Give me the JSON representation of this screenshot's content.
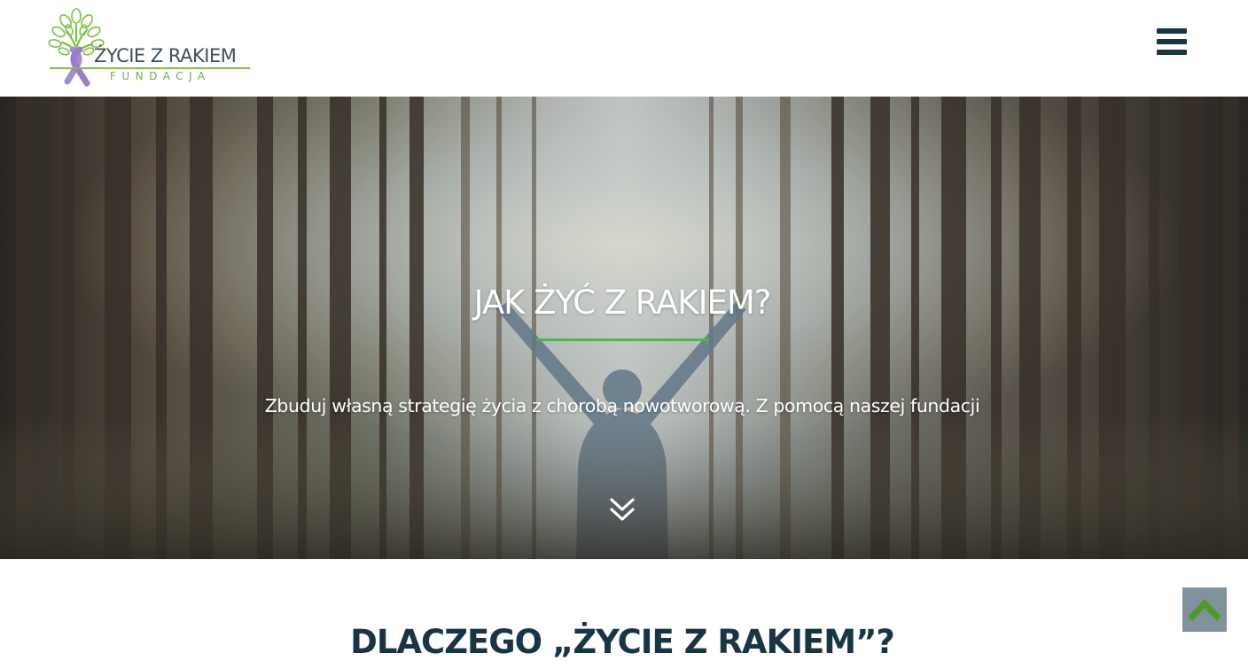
{
  "header": {
    "logo": {
      "title": "ŻYCIE Z RAKIEM",
      "subtitle": "FUNDACJA",
      "icon": "tree-ribbon-logo"
    },
    "menu_icon": "hamburger-menu-icon"
  },
  "hero": {
    "title": "JAK ŻYĆ Z RAKIEM?",
    "subtitle": "Zbuduj własną strategię życia z chorobą nowotworową. Z pomocą naszej fundacji",
    "scroll_icon": "double-chevron-down-icon",
    "accent_color": "#4cb848"
  },
  "section": {
    "title": "DLACZEGO „ŻYCIE Z RAKIEM”?"
  },
  "back_to_top": {
    "icon": "chevron-up-icon",
    "icon_color": "#4a9a2a",
    "bg_color": "#80929c"
  },
  "colors": {
    "brand_dark": "#173543",
    "brand_green": "#7cc142",
    "ribbon_purple": "#a98bd0"
  }
}
